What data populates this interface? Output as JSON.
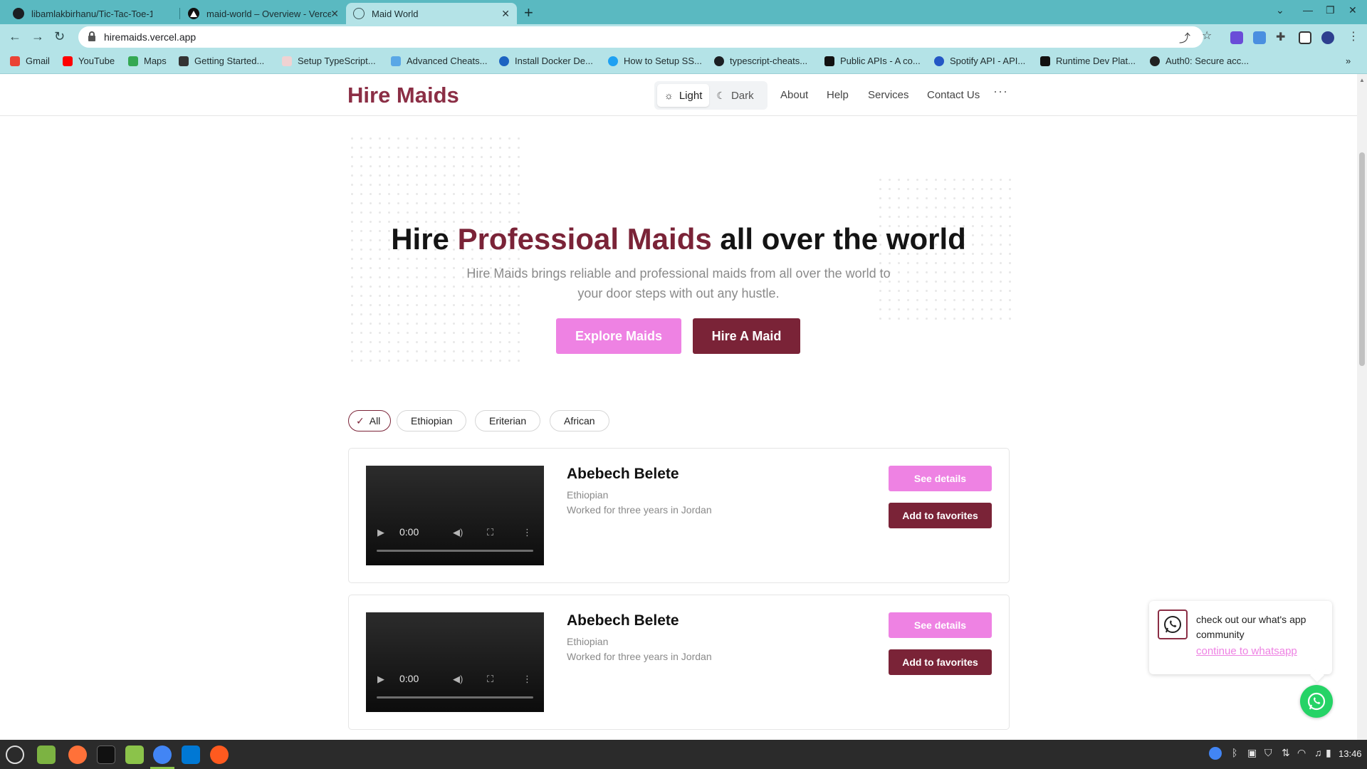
{
  "browser": {
    "tabs": [
      {
        "title": "libamlakbirhanu/Tic-Tac-Toe-1"
      },
      {
        "title": "maid-world – Overview - Vercel"
      },
      {
        "title": "Maid World"
      }
    ],
    "new_tab": "+",
    "url": "hiremaids.vercel.app",
    "bookmarks": [
      "Gmail",
      "YouTube",
      "Maps",
      "Getting Started...",
      "Setup TypeScript...",
      "Advanced Cheats...",
      "Install Docker De...",
      "How to Setup SS...",
      "typescript-cheats...",
      "Public APIs - A co...",
      "Spotify API - API...",
      "Runtime Dev Plat...",
      "Auth0: Secure acc..."
    ],
    "bookmarks_more": "»"
  },
  "site": {
    "brand": "Hire Maids",
    "theme": {
      "light": "Light",
      "dark": "Dark"
    },
    "nav": [
      "About",
      "Help",
      "Services",
      "Contact Us"
    ],
    "more": "···"
  },
  "hero": {
    "title_pre": "Hire ",
    "title_accent": "Professioal Maids",
    "title_post": " all over the world",
    "subtitle": "Hire Maids brings reliable and professional maids from all over the world to your door steps with out any hustle.",
    "explore": "Explore Maids",
    "hire": "Hire A Maid"
  },
  "filters": [
    "All",
    "Ethiopian",
    "Eriterian",
    "African"
  ],
  "maids": [
    {
      "name": "Abebech Belete",
      "nationality": "Ethiopian",
      "experience": "Worked for three years in Jordan",
      "video_time": "0:00",
      "details": "See details",
      "favorite": "Add to favorites"
    },
    {
      "name": "Abebech Belete",
      "nationality": "Ethiopian",
      "experience": "Worked for three years in Jordan",
      "video_time": "0:00",
      "details": "See details",
      "favorite": "Add to favorites"
    }
  ],
  "whatsapp": {
    "text": "check out our what's app community",
    "link": "continue to whatsapp"
  },
  "taskbar": {
    "clock": "13:46"
  },
  "colors": {
    "brand": "#7a2337",
    "accent_pink": "#ee82e3",
    "chrome": "#b4e3e7"
  }
}
